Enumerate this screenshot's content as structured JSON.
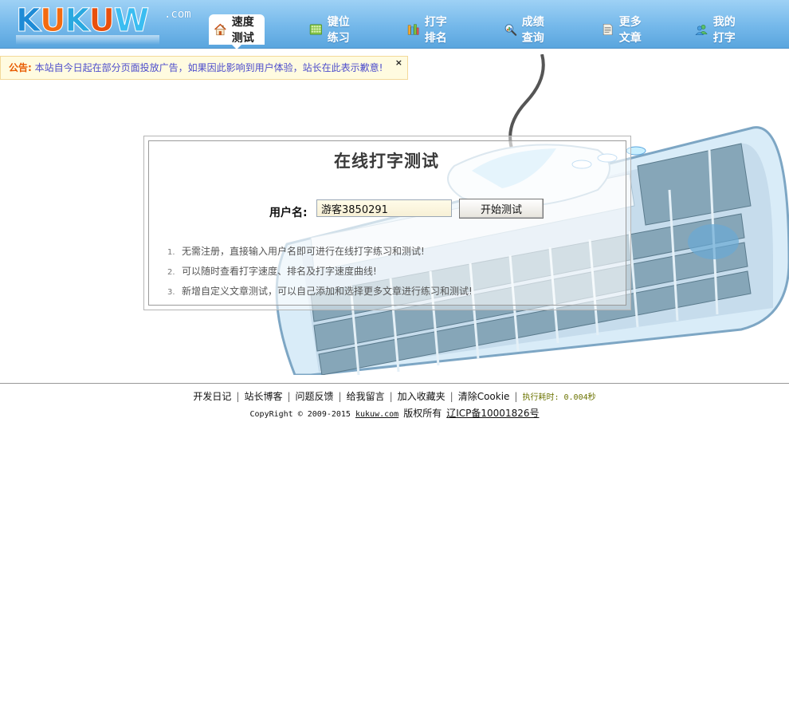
{
  "logo": {
    "text": "KUKUW",
    "suffix": ".com"
  },
  "nav": [
    {
      "label": "速度测试",
      "icon": "home-icon",
      "active": true
    },
    {
      "label": "键位练习",
      "icon": "keyboard-grid-icon",
      "active": false
    },
    {
      "label": "打字排名",
      "icon": "books-icon",
      "active": false
    },
    {
      "label": "成绩查询",
      "icon": "magnifier-chart-icon",
      "active": false
    },
    {
      "label": "更多文章",
      "icon": "document-icon",
      "active": false
    },
    {
      "label": "我的打字",
      "icon": "users-icon",
      "active": false
    }
  ],
  "notice": {
    "label": "公告:",
    "text": "本站自今日起在部分页面投放广告，如果因此影响到用户体验，站长在此表示歉意!",
    "close": "×"
  },
  "test": {
    "title": "在线打字测试",
    "username_label": "用户名:",
    "username_value": "游客3850291",
    "start_button": "开始测试",
    "tips": [
      {
        "num": "1.",
        "text": "无需注册，直接输入用户名即可进行在线打字练习和测试!"
      },
      {
        "num": "2.",
        "text": "可以随时查看打字速度、排名及打字速度曲线!"
      },
      {
        "num": "3.",
        "text": "新增自定义文章测试，可以自己添加和选择更多文章进行练习和测试!"
      }
    ]
  },
  "footer": {
    "links": [
      "开发日记",
      "站长博客",
      "问题反馈",
      "给我留言",
      "加入收藏夹",
      "清除Cookie"
    ],
    "separator": "|",
    "timing": "执行耗时: 0.004秒",
    "copyright_prefix": "CopyRight © 2009-2015",
    "site_link": "kukuw.com",
    "rights": "版权所有",
    "icp": "辽ICP备10001826号"
  },
  "colors": {
    "header_top": "#9ed1f5",
    "header_bottom": "#5aa5de",
    "notice_bg": "#fffbe0",
    "notice_label": "#e85a00",
    "notice_text": "#4d4dcc"
  }
}
